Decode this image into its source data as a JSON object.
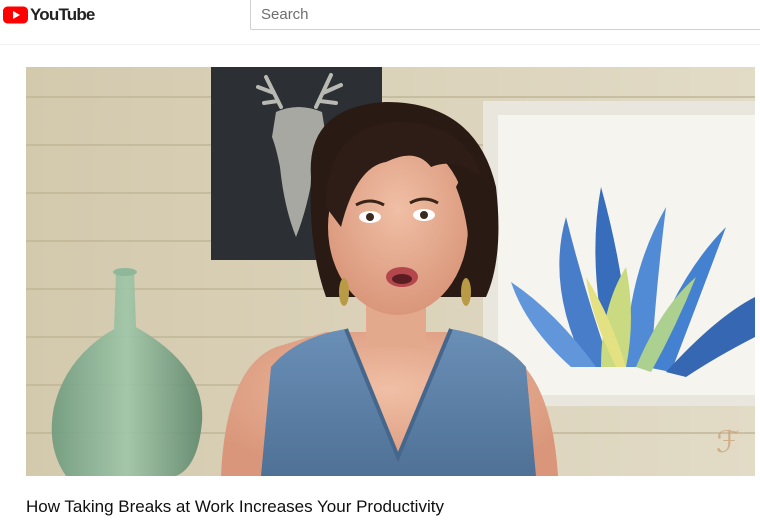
{
  "header": {
    "logo_text": "YouTube",
    "logo_icon": "youtube-play-icon",
    "search_placeholder": "Search"
  },
  "video": {
    "title": "How Taking Breaks at Work Increases Your Productivity",
    "thumbnail_icon": "video-frame",
    "colors": {
      "brand_red": "#ff0000",
      "wall": "#d9d0b6",
      "dress": "#5b7fa6"
    }
  }
}
